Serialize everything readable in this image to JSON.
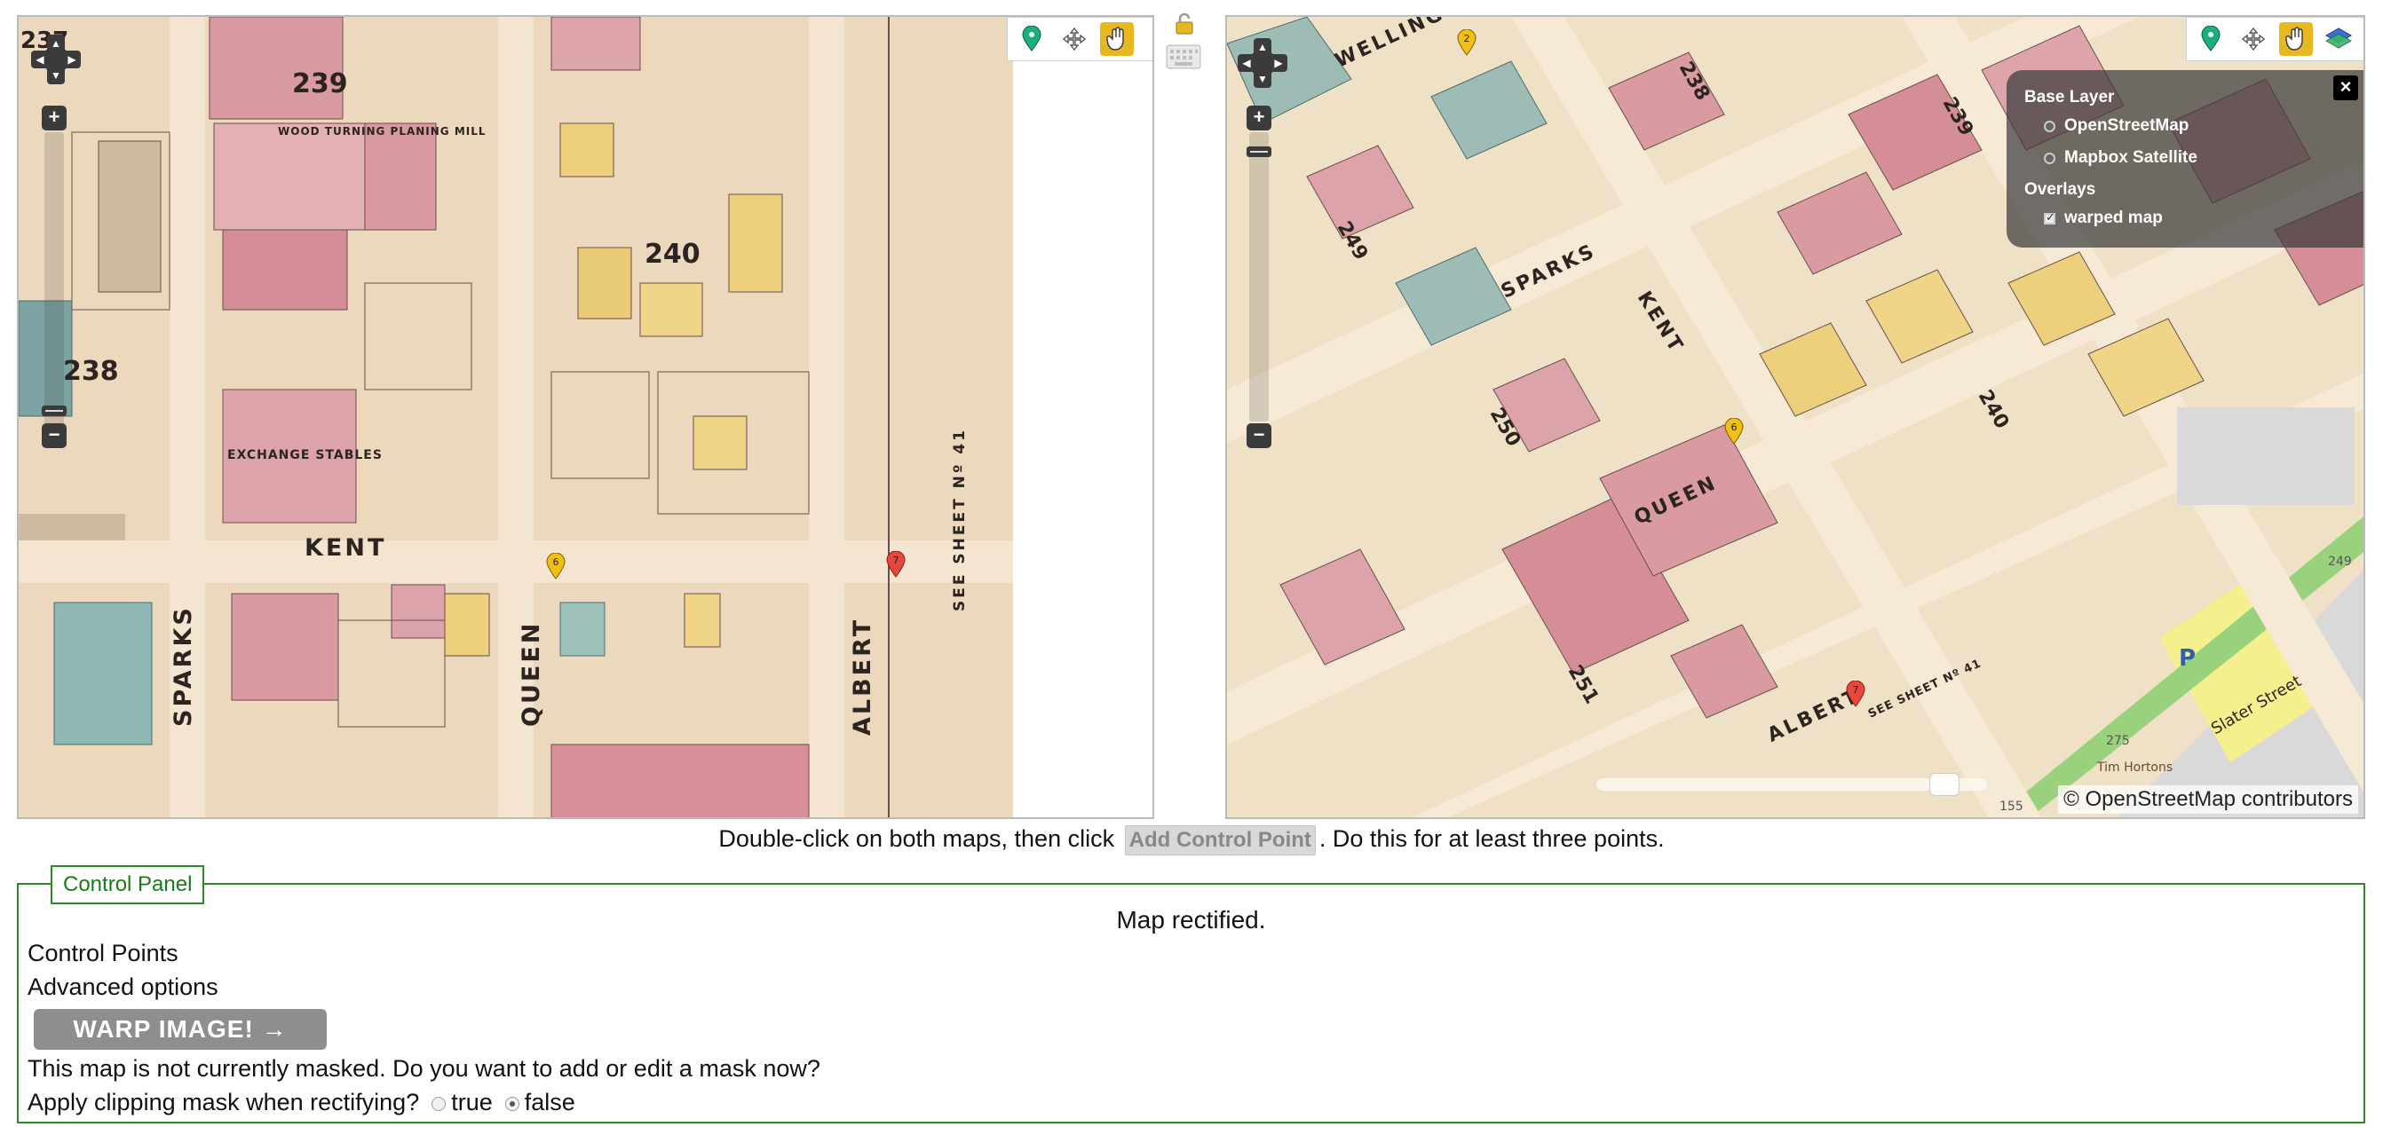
{
  "left_map": {
    "labels": {
      "street_kent": "KENT",
      "street_sparks": "SPARKS",
      "street_queen": "QUEEN",
      "street_albert": "ALBERT",
      "see_sheet": "SEE SHEET Nº 41",
      "block_239": "239",
      "block_240": "240",
      "block_238": "238",
      "block_237": "237",
      "building_exchange": "EXCHANGE STABLES",
      "building_planing": "WOOD TURNING PLANING MILL"
    },
    "markers": [
      {
        "label": "6",
        "color": "#f2c014"
      },
      {
        "label": "7",
        "color": "#e8473c"
      }
    ],
    "tools": [
      "add-point-icon",
      "move-icon",
      "pan-hand-icon"
    ],
    "active_tool": "pan-hand-icon"
  },
  "right_map": {
    "labels": {
      "street_wellington": "WELLINGTON",
      "street_sparks": "SPARKS",
      "street_kent": "KENT",
      "street_queen": "QUEEN",
      "street_albert": "ALBERT",
      "street_slater": "Slater Street",
      "block_238": "238",
      "block_239": "239",
      "block_249": "249",
      "block_250": "250",
      "block_240": "240",
      "block_251": "251",
      "see_sheet": "SEE SHEET Nº 41",
      "parking": "P",
      "poi_tim": "Tim Hortons",
      "num_275": "275",
      "num_155": "155",
      "num_249": "249"
    },
    "markers": [
      {
        "label": "2",
        "color": "#f2c014"
      },
      {
        "label": "6",
        "color": "#f2c014"
      },
      {
        "label": "7",
        "color": "#e8473c"
      }
    ],
    "tools": [
      "add-point-icon",
      "move-icon",
      "pan-hand-icon",
      "layers-icon"
    ],
    "active_tool": "pan-hand-icon",
    "layer_switcher": {
      "base_layer_title": "Base Layer",
      "base_layers": [
        "OpenStreetMap",
        "Mapbox Satellite"
      ],
      "overlays_title": "Overlays",
      "overlays": [
        "warped map"
      ],
      "close_label": "×"
    },
    "attribution": "© OpenStreetMap contributors"
  },
  "instruction": {
    "before": "Double-click on both maps, then click",
    "button": "Add Control Point",
    "after": ". Do this for at least three points."
  },
  "control_panel": {
    "legend": "Control Panel",
    "status": "Map rectified.",
    "control_points": "Control Points",
    "advanced_options": "Advanced options",
    "warp_button": "WARP IMAGE! →",
    "mask_prompt": "This map is not currently masked. Do you want to add or edit a mask now?",
    "clip_question": "Apply clipping mask when rectifying?",
    "options": [
      "true",
      "false"
    ],
    "selected": "false"
  }
}
